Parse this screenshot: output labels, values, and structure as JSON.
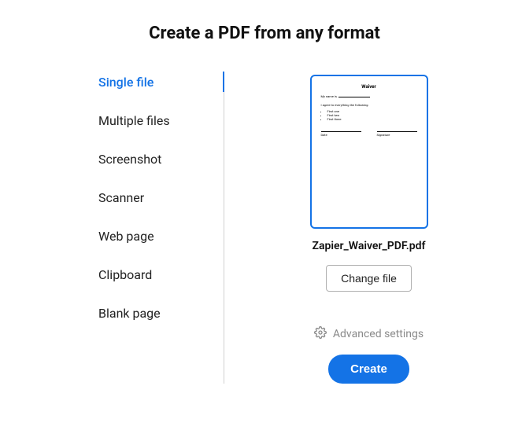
{
  "title": "Create a PDF from any format",
  "sidebar": {
    "items": [
      {
        "label": "Single file",
        "active": true
      },
      {
        "label": "Multiple files",
        "active": false
      },
      {
        "label": "Screenshot",
        "active": false
      },
      {
        "label": "Scanner",
        "active": false
      },
      {
        "label": "Web page",
        "active": false
      },
      {
        "label": "Clipboard",
        "active": false
      },
      {
        "label": "Blank page",
        "active": false
      }
    ]
  },
  "main": {
    "filename": "Zapier_Waiver_PDF.pdf",
    "change_file_label": "Change file",
    "advanced_label": "Advanced settings",
    "create_label": "Create",
    "preview": {
      "heading": "Waiver",
      "name_label": "My name is",
      "agree_label": "I agree to everything the following:",
      "bullets": [
        "First one",
        "First two",
        "First three"
      ],
      "date_label": "Date",
      "signature_label": "Signature"
    }
  }
}
